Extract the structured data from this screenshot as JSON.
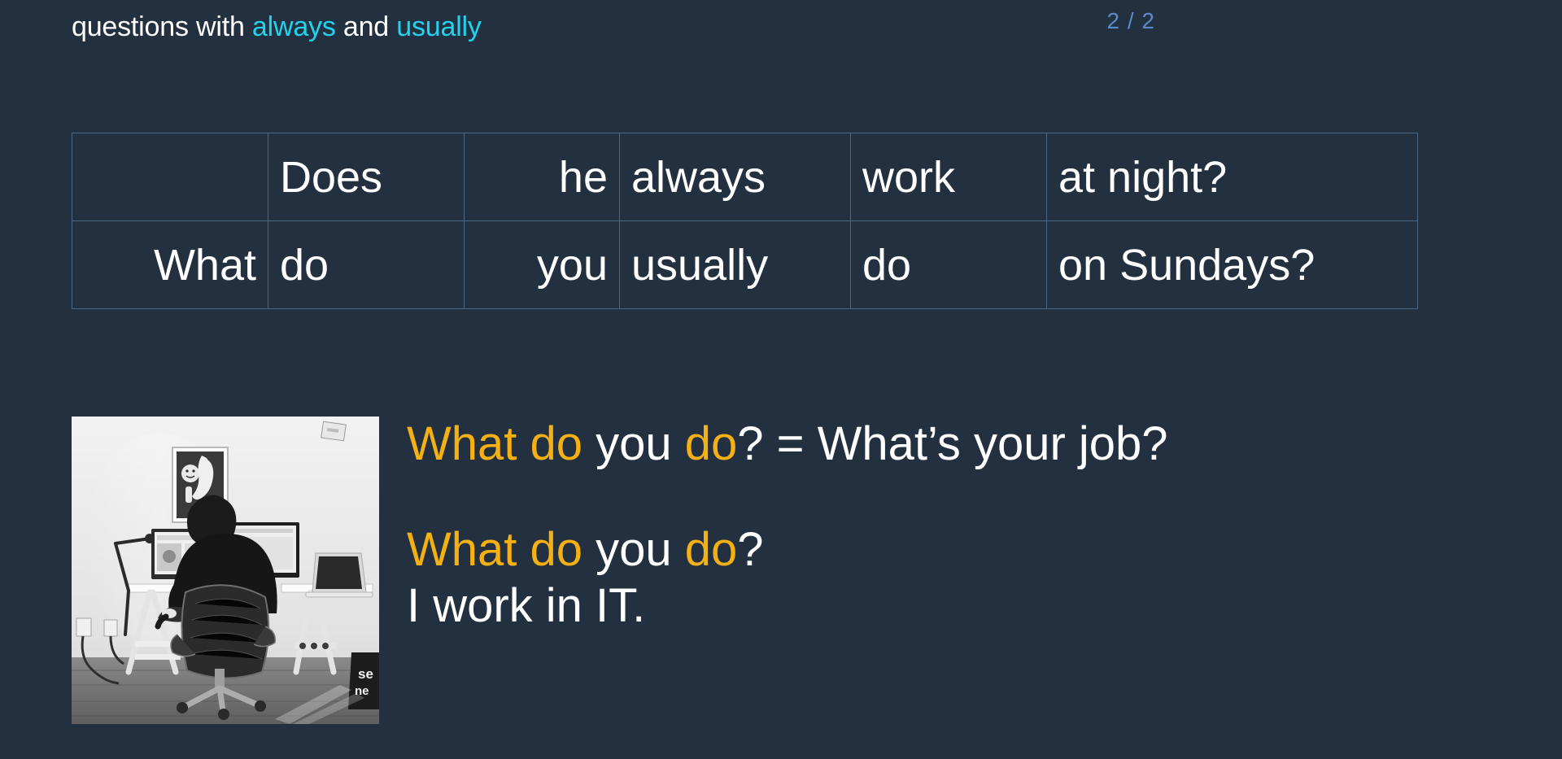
{
  "slide": {
    "title_parts": [
      {
        "text": "questions with ",
        "color": "white"
      },
      {
        "text": "always",
        "color": "cyan"
      },
      {
        "text": " and ",
        "color": "white"
      },
      {
        "text": "usually",
        "color": "cyan"
      }
    ],
    "title_plain": "questions with always and usually",
    "page_indicator": "2 / 2",
    "background_color": "#22303f",
    "accent_colors": {
      "amber": "#f5b014",
      "cyan": "#22d3ee",
      "white": "#ffffff",
      "border": "#4d6885",
      "page_number": "#5b8ac9"
    }
  },
  "table": {
    "columns": [
      "question-word",
      "auxiliary",
      "subject",
      "adverb",
      "main-verb",
      "rest"
    ],
    "rows": [
      {
        "cells": [
          {
            "text": "",
            "color": "white",
            "align": "right"
          },
          {
            "text": "Does",
            "color": "amber",
            "align": "left"
          },
          {
            "text": "he",
            "color": "white",
            "align": "right"
          },
          {
            "text": "always",
            "color": "cyan",
            "align": "left"
          },
          {
            "text": "work",
            "color": "amber",
            "align": "left"
          },
          {
            "text": "at night?",
            "color": "white",
            "align": "left"
          }
        ]
      },
      {
        "cells": [
          {
            "text": "What",
            "color": "white",
            "align": "right"
          },
          {
            "text": "do",
            "color": "amber",
            "align": "left"
          },
          {
            "text": "you",
            "color": "white",
            "align": "right"
          },
          {
            "text": "usually",
            "color": "cyan",
            "align": "left"
          },
          {
            "text": "do",
            "color": "amber",
            "align": "left"
          },
          {
            "text": "on Sundays?",
            "color": "white",
            "align": "left"
          }
        ]
      }
    ]
  },
  "photo": {
    "description": "black-and-white photo of a man seated at a standing desk with two monitors, a laptop and an office chair",
    "alt": "person working at a desk"
  },
  "examples": [
    {
      "id": "example-1",
      "parts": [
        {
          "text": "What do ",
          "color": "amber"
        },
        {
          "text": "you ",
          "color": "white"
        },
        {
          "text": "do",
          "color": "amber"
        },
        {
          "text": "? = What’s your job?",
          "color": "white"
        }
      ],
      "plain": "What do you do? = What’s your job?"
    },
    {
      "id": "example-2",
      "parts": [
        {
          "text": "What do ",
          "color": "amber"
        },
        {
          "text": "you ",
          "color": "white"
        },
        {
          "text": "do",
          "color": "amber"
        },
        {
          "text": "?",
          "color": "white"
        }
      ],
      "plain": "What do you do?"
    },
    {
      "id": "example-3",
      "parts": [
        {
          "text": "I work in IT.",
          "color": "white"
        }
      ],
      "plain": "I work in IT."
    }
  ]
}
